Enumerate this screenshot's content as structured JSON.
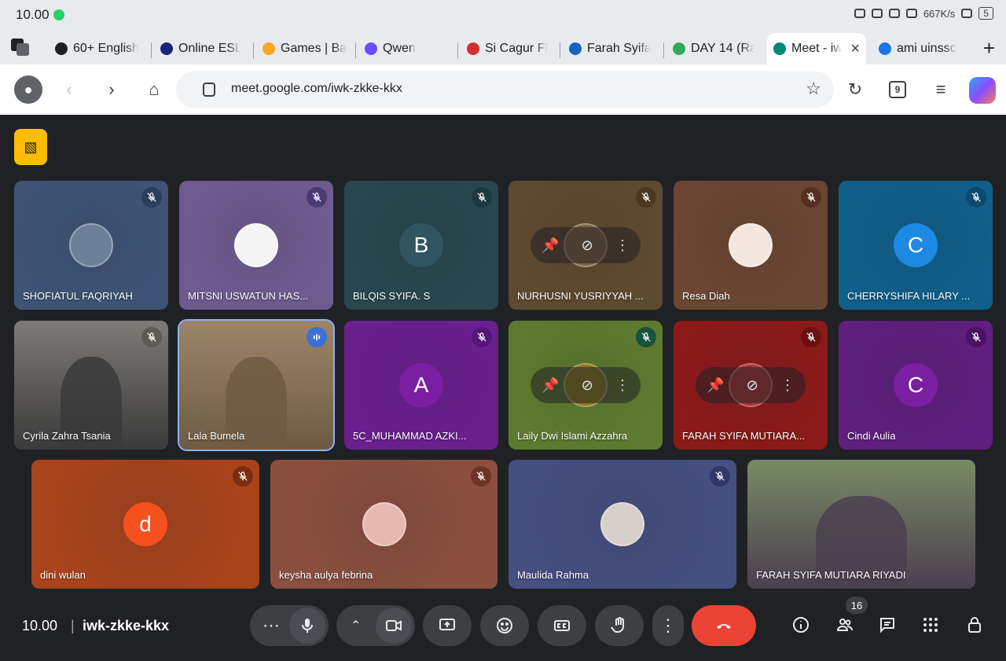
{
  "status": {
    "time": "10.00",
    "net_speed": "667K/s",
    "battery": "5"
  },
  "tabs": [
    {
      "label": "60+ English",
      "fav_color": "#202124"
    },
    {
      "label": "Online ESL",
      "fav_color": "#1a237e"
    },
    {
      "label": "Games | Ba",
      "fav_color": "#f9a825"
    },
    {
      "label": "Qwen",
      "fav_color": "#6c4dff"
    },
    {
      "label": "Si Cagur Fl",
      "fav_color": "#d32f2f"
    },
    {
      "label": "Farah Syifa",
      "fav_color": "#1565c0"
    },
    {
      "label": "DAY 14 (Ra",
      "fav_color": "#34a853"
    },
    {
      "label": "Meet - iw",
      "fav_color": "#00897b",
      "active": true
    },
    {
      "label": "ami uinssc",
      "fav_color": "#1a73e8"
    }
  ],
  "browser": {
    "url": "meet.google.com/iwk-zkke-kkx",
    "tab_count": "9"
  },
  "participants": [
    {
      "name": "SHOFIATUL FAQRIYAH",
      "bg": "#3e5375",
      "mic_bg": "#2b3e5c",
      "avatar": "photo",
      "avatar_color": "#6d7f99"
    },
    {
      "name": "MITSNI USWATUN HAS...",
      "bg": "#6d5b8f",
      "mic_bg": "#4a3a73",
      "avatar": "photo",
      "avatar_color": "#f5f5f5"
    },
    {
      "name": "BILQIS SYIFA. S",
      "bg": "#28474f",
      "mic_bg": "#1d3840",
      "avatar": "letter",
      "letter": "B",
      "avatar_color": "#2f5560"
    },
    {
      "name": "NURHUSNI YUSRIYYAH ...",
      "bg": "#5e4a2e",
      "mic_bg": "#4a3820",
      "avatar": "pin",
      "avatar_color": "#7a6242"
    },
    {
      "name": "Resa Diah",
      "bg": "#6b4632",
      "mic_bg": "#552f1f",
      "avatar": "photo",
      "avatar_color": "#f3e6dd"
    },
    {
      "name": "CHERRYSHIFA HILARY ...",
      "bg": "#0f5f8a",
      "mic_bg": "#0b4a6e",
      "avatar": "letter",
      "letter": "C",
      "avatar_color": "#1e88e5"
    },
    {
      "name": "Cyrila Zahra Tsania",
      "bg": "#7e7b77",
      "mic_bg": "#5e5b57",
      "avatar": "video",
      "avatar_color": "#3a3a3a"
    },
    {
      "name": "Lala Bumela",
      "bg": "#9c8569",
      "mic_bg": "#3c70d6",
      "avatar": "video",
      "avatar_color": "#6e5a45",
      "speaking": true
    },
    {
      "name": "5C_MUHAMMAD AZKI...",
      "bg": "#6a1f8f",
      "mic_bg": "#56157a",
      "avatar": "letter",
      "letter": "A",
      "avatar_color": "#7b1fa2"
    },
    {
      "name": "Laily Dwi Islami Azzahra",
      "bg": "#5d7a2f",
      "mic_bg": "#17523a",
      "avatar": "pin",
      "avatar_color": "#8a7a1f"
    },
    {
      "name": "FARAH SYIFA MUTIARA...",
      "bg": "#8b1a1a",
      "mic_bg": "#6b1010",
      "avatar": "pin",
      "avatar_color": "#a33"
    },
    {
      "name": "Cindi Aulia",
      "bg": "#5e1f7e",
      "mic_bg": "#4a1466",
      "avatar": "letter",
      "letter": "C",
      "avatar_color": "#7b1fa2"
    },
    {
      "name": "dini wulan",
      "bg": "#a8431c",
      "mic_bg": "#7e2c10",
      "avatar": "letter",
      "letter": "d",
      "avatar_color": "#f4511e"
    },
    {
      "name": "keysha aulya febrina",
      "bg": "#8a4f3e",
      "mic_bg": "#6b3426",
      "avatar": "photo",
      "avatar_color": "#e8b8b0"
    },
    {
      "name": "Maulida Rahma",
      "bg": "#454f80",
      "mic_bg": "#2f3866",
      "avatar": "photo",
      "avatar_color": "#d7cfc9"
    },
    {
      "name": "FARAH SYIFA MUTIARA RIYADI",
      "bg": "#7a8a66",
      "mic_bg": "transparent",
      "avatar": "video",
      "avatar_color": "#4a3f4f"
    }
  ],
  "meeting": {
    "time": "10.00",
    "code": "iwk-zkke-kkx",
    "people_count": "16"
  }
}
